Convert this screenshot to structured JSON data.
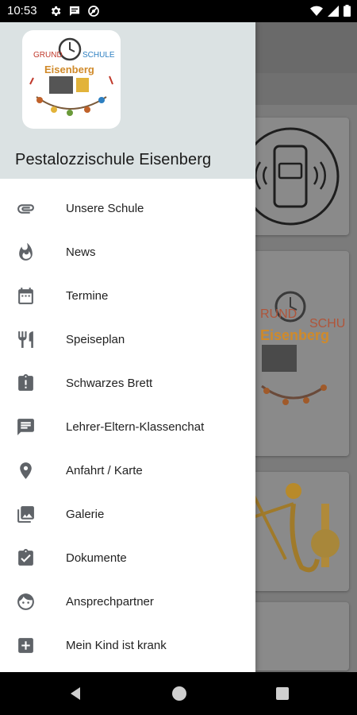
{
  "status_bar": {
    "time": "10:53",
    "icons_left": [
      "gear-icon",
      "message-icon",
      "no-disturb-icon"
    ],
    "icons_right": [
      "wifi-icon",
      "signal-icon",
      "battery-icon"
    ]
  },
  "drawer": {
    "header": {
      "title": "Pestalozzischule Eisenberg",
      "logo_text_top": "GRUNDSCHULE",
      "logo_text_mid": "Eisenberg",
      "logo_colors": [
        "#e2b33a",
        "#c0392b",
        "#2d7fc1",
        "#6a9a3a"
      ]
    },
    "items": [
      {
        "label": "Unsere Schule",
        "icon": "paperclip-icon"
      },
      {
        "label": "News",
        "icon": "flame-icon"
      },
      {
        "label": "Termine",
        "icon": "calendar-icon"
      },
      {
        "label": "Speiseplan",
        "icon": "cutlery-icon"
      },
      {
        "label": "Schwarzes Brett",
        "icon": "clipboard-alert-icon"
      },
      {
        "label": "Lehrer-Eltern-Klassenchat",
        "icon": "chat-icon"
      },
      {
        "label": "Anfahrt / Karte",
        "icon": "location-pin-icon"
      },
      {
        "label": "Galerie",
        "icon": "gallery-icon"
      },
      {
        "label": "Dokumente",
        "icon": "clipboard-check-icon"
      },
      {
        "label": "Ansprechpartner",
        "icon": "face-icon"
      },
      {
        "label": "Mein Kind ist krank",
        "icon": "medical-cross-icon"
      }
    ]
  },
  "navigation_bar": {
    "buttons": [
      "back-icon",
      "home-icon",
      "recent-apps-icon"
    ]
  },
  "colors": {
    "drawer_header_bg": "#dbe2e3",
    "icon_gray": "#5f6368",
    "scrim": "#7b7b7b"
  }
}
